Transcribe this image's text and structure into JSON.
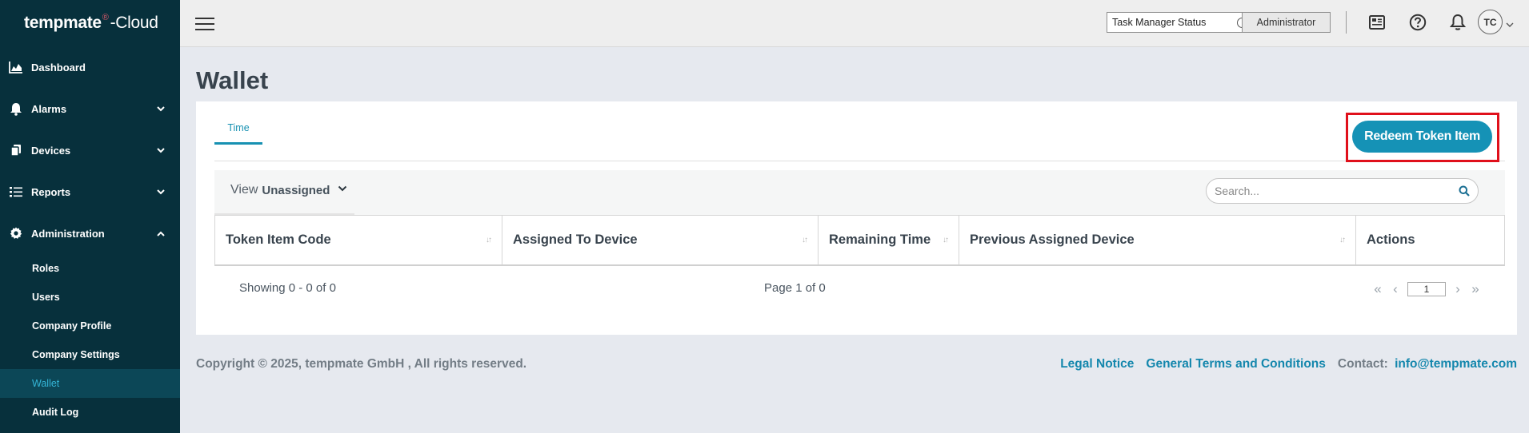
{
  "app": {
    "logo_brand": "tempmate",
    "logo_mark": "®",
    "logo_suffix": "-Cloud"
  },
  "sidebar": {
    "items": [
      {
        "label": "Dashboard",
        "icon": "area-chart-icon"
      },
      {
        "label": "Alarms",
        "icon": "bell-icon"
      },
      {
        "label": "Devices",
        "icon": "devices-icon"
      },
      {
        "label": "Reports",
        "icon": "list-icon"
      },
      {
        "label": "Administration",
        "icon": "gear-icon"
      }
    ],
    "sub_items": [
      {
        "label": "Roles"
      },
      {
        "label": "Users"
      },
      {
        "label": "Company Profile"
      },
      {
        "label": "Company Settings"
      },
      {
        "label": "Wallet",
        "active": true
      },
      {
        "label": "Audit Log"
      }
    ]
  },
  "topbar": {
    "task_manager_status": "Task Manager Status",
    "role_button": "Administrator",
    "avatar_initials": "TC"
  },
  "page": {
    "title": "Wallet",
    "tabs": [
      {
        "label": "Time"
      }
    ],
    "redeem_button": "Redeem Token Item",
    "view_label": "View",
    "view_value": "Unassigned",
    "search_placeholder": "Search...",
    "table": {
      "columns": [
        "Token Item Code",
        "Assigned To Device",
        "Remaining Time",
        "Previous Assigned Device",
        "Actions"
      ]
    },
    "showing_text": "Showing 0 - 0 of 0",
    "page_text": "Page 1 of 0",
    "current_page": "1"
  },
  "footer": {
    "copyright": "Copyright © 2025, tempmate GmbH , All rights reserved.",
    "legal_notice": "Legal Notice",
    "terms": "General Terms and Conditions",
    "contact_label": "Contact:",
    "contact_email": "info@tempmate.com"
  },
  "colors": {
    "sidebar_bg": "#07303c",
    "accent": "#1592b6",
    "highlight_border": "#e0101b"
  }
}
